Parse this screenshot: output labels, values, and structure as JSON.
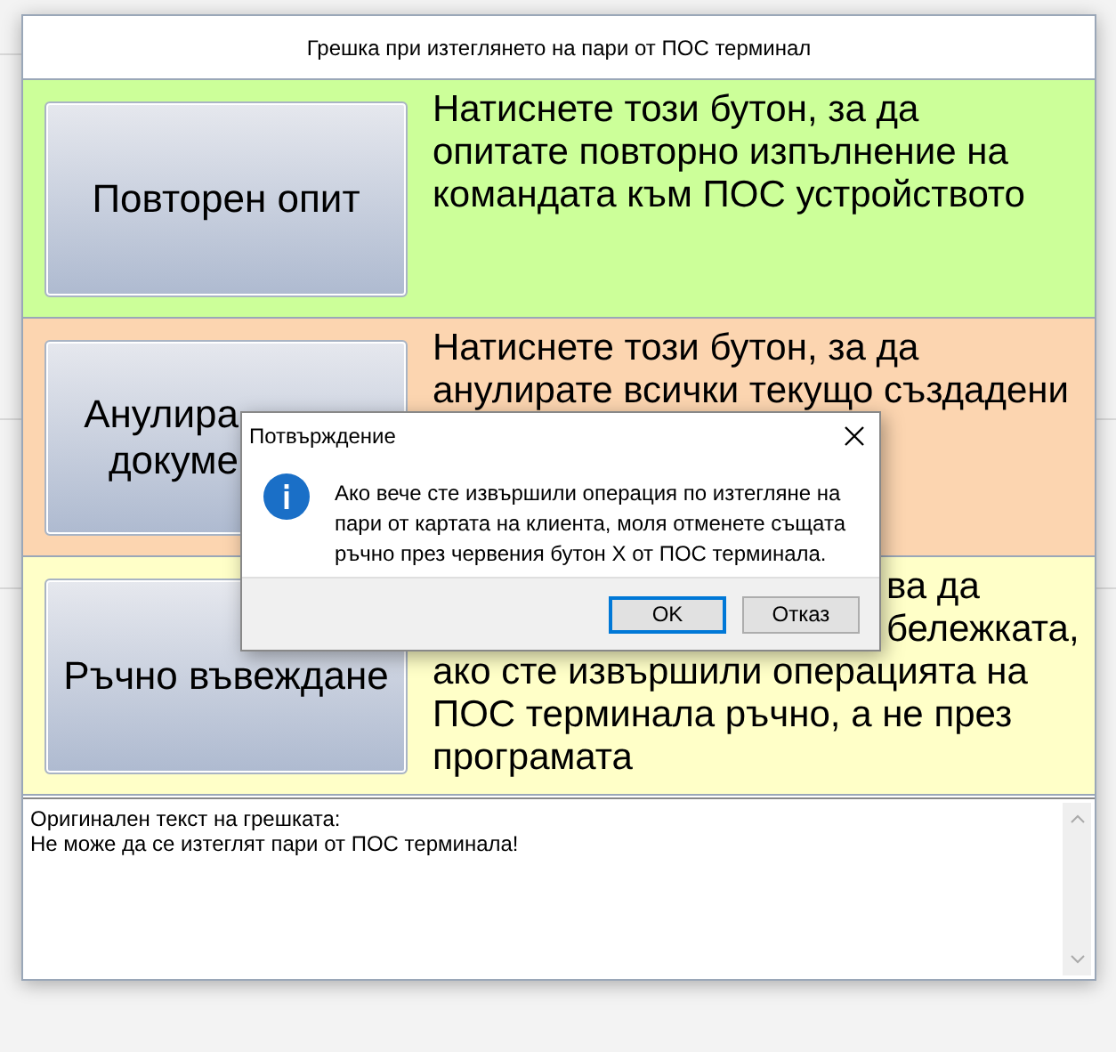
{
  "window": {
    "title": "Грешка при изтеглянето на пари от ПОС терминал"
  },
  "options": [
    {
      "color": "#ccff99",
      "button": [
        "Повторен опит"
      ],
      "description": [
        "Натиснете този бутон, за да",
        "опитате повторно изпълнение на",
        "командата към ПОС устройството"
      ]
    },
    {
      "color": "#fcd5b0",
      "button_partial": [
        "Анулира",
        "докуме"
      ],
      "description": [
        "Натиснете този бутон, за да",
        "анулирате всички текущо създадени"
      ]
    },
    {
      "color": "#ffffc8",
      "button": [
        "Ръчно въвеждане"
      ],
      "description_partial": [
        "ва да",
        "бележката,"
      ],
      "description": [
        "ако сте извършили операцията на",
        "ПОС терминала ръчно, а не през",
        "програмата"
      ]
    }
  ],
  "error_text": {
    "lines": [
      "Оригинален текст на грешката:",
      "Не може да се изтеглят пари от ПОС терминала!"
    ]
  },
  "dialog": {
    "title": "Потвърждение",
    "message": "Ако вече сте извършили операция по изтегляне на пари от картата на клиента, моля отменете същата ръчно през червения бутон X от ПОС терминала.",
    "buttons": [
      {
        "label": "OK",
        "selected": true
      },
      {
        "label": "Отказ",
        "selected": false
      }
    ]
  }
}
